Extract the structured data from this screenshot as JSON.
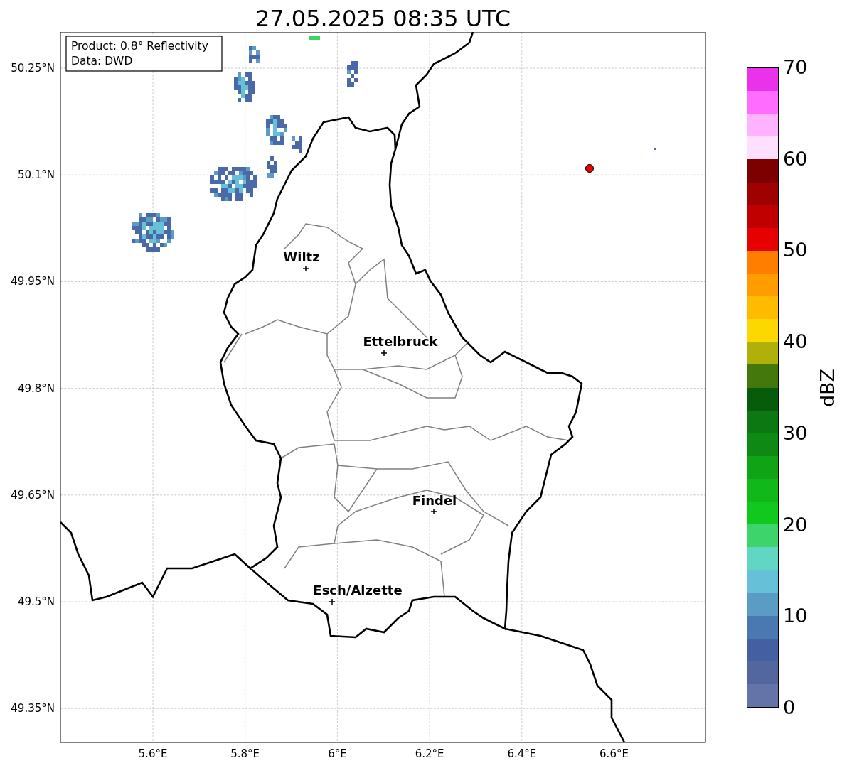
{
  "title": "27.05.2025 08:35 UTC",
  "info_box": [
    "Product: 0.8° Reflectivity",
    "Data: DWD"
  ],
  "map": {
    "lat_ticks": [
      "50.25°N",
      "50.1°N",
      "49.95°N",
      "49.8°N",
      "49.65°N",
      "49.5°N",
      "49.35°N"
    ],
    "lon_ticks": [
      "5.6°E",
      "5.8°E",
      "6°E",
      "6.2°E",
      "6.4°E",
      "6.6°E"
    ],
    "cities": [
      {
        "name": "Wiltz"
      },
      {
        "name": "Ettelbruck"
      },
      {
        "name": "Findel"
      },
      {
        "name": "Esch/Alzette"
      }
    ]
  },
  "colorbar": {
    "label": "dBZ",
    "ticks": [
      "70",
      "60",
      "50",
      "40",
      "30",
      "20",
      "10",
      "0"
    ],
    "segments": [
      {
        "color": "#eb32eb"
      },
      {
        "color": "#ff6cff"
      },
      {
        "color": "#ffb2ff"
      },
      {
        "color": "#ffdfff"
      },
      {
        "color": "#7c0000"
      },
      {
        "color": "#9f0000"
      },
      {
        "color": "#c00000"
      },
      {
        "color": "#e70000"
      },
      {
        "color": "#ff7e00"
      },
      {
        "color": "#ff9c00"
      },
      {
        "color": "#ffbb00"
      },
      {
        "color": "#fdd700"
      },
      {
        "color": "#afb00a"
      },
      {
        "color": "#44770c"
      },
      {
        "color": "#075c0c"
      },
      {
        "color": "#0c7812"
      },
      {
        "color": "#0e8a14"
      },
      {
        "color": "#0fa315"
      },
      {
        "color": "#10b81a"
      },
      {
        "color": "#10c81e"
      },
      {
        "color": "#3ed46c"
      },
      {
        "color": "#62d6c4"
      },
      {
        "color": "#66c0d8"
      },
      {
        "color": "#5b9cc4"
      },
      {
        "color": "#4a78b0"
      },
      {
        "color": "#445fa2"
      },
      {
        "color": "#53669e"
      },
      {
        "color": "#6474a8"
      }
    ]
  }
}
